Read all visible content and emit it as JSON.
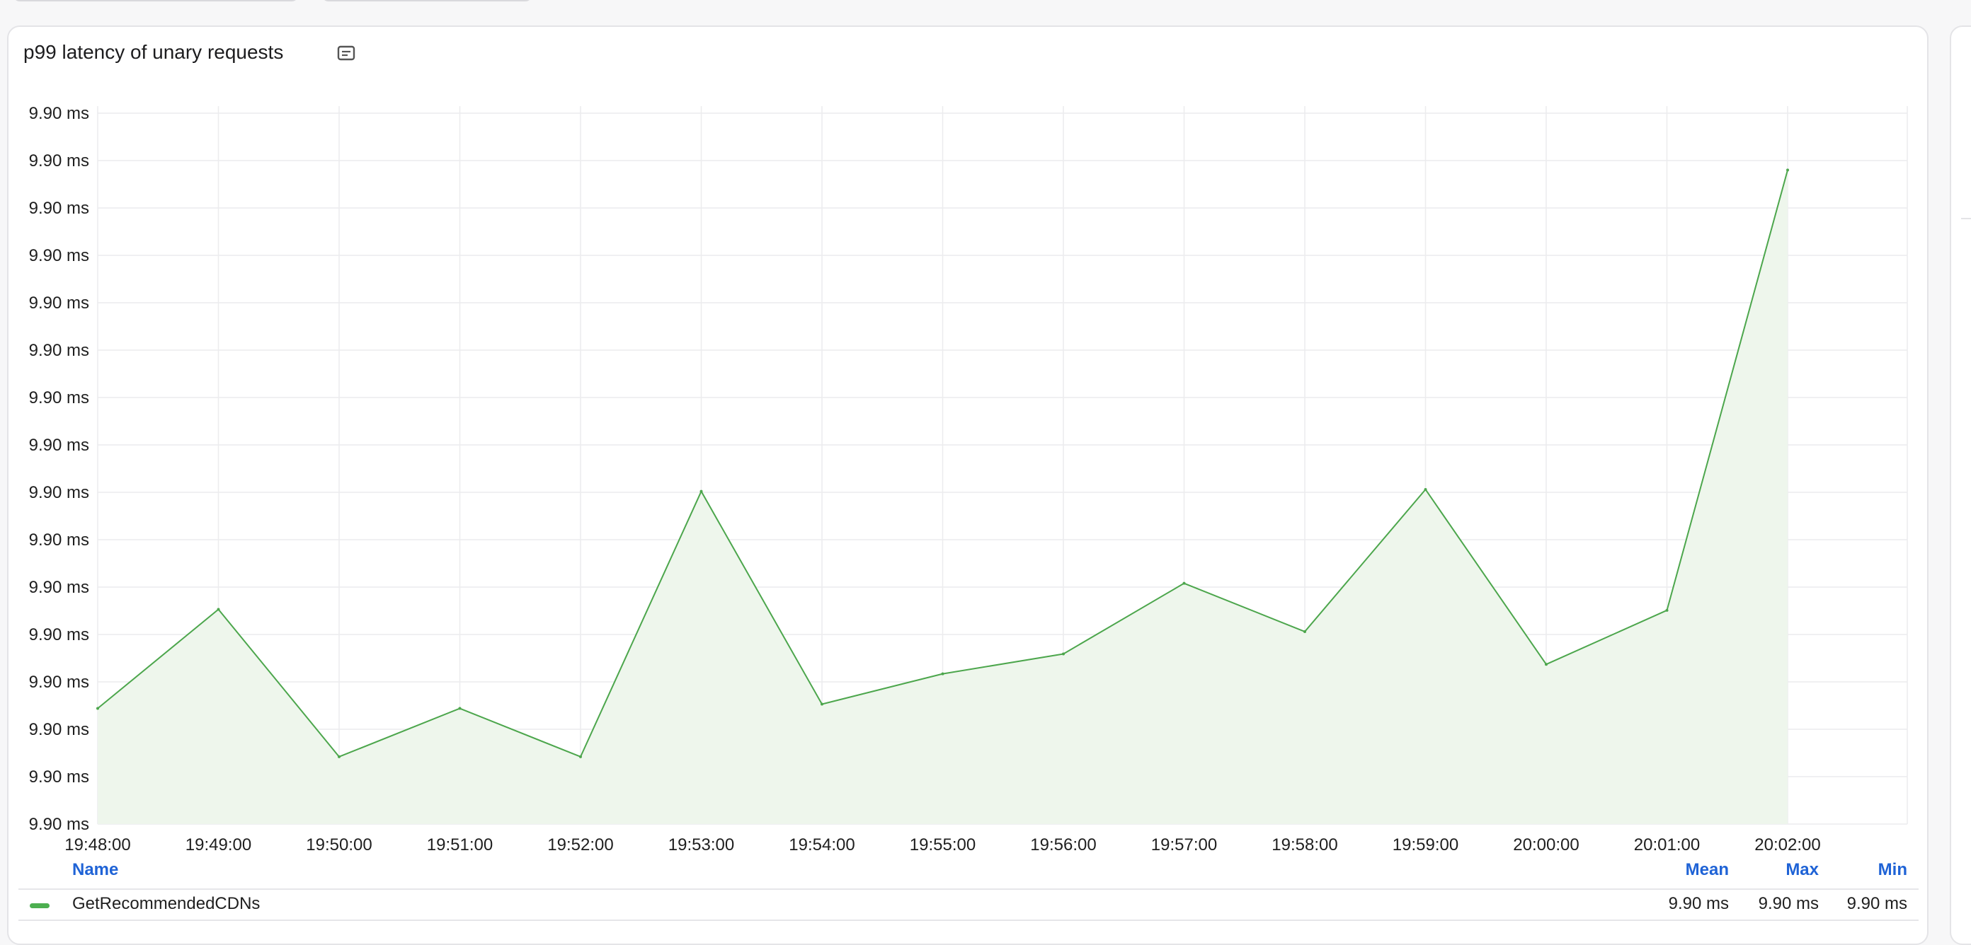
{
  "panel": {
    "title": "p99 latency of unary requests",
    "info_icon": "description-icon"
  },
  "legend": {
    "headers": {
      "name": "Name",
      "mean": "Mean",
      "max": "Max",
      "min": "Min"
    },
    "rows": [
      {
        "name": "GetRecommendedCDNs",
        "mean": "9.90 ms",
        "max": "9.90 ms",
        "min": "9.90 ms",
        "color": "#4caf50"
      }
    ]
  },
  "colors": {
    "line": "#4ca64c",
    "fill": "#eef6ec",
    "grid": "#ececee",
    "header": "#1f63d6"
  },
  "chart_data": {
    "type": "area",
    "title": "p99 latency of unary requests",
    "xlabel": "",
    "ylabel": "",
    "x": [
      "19:48:00",
      "19:49:00",
      "19:50:00",
      "19:51:00",
      "19:52:00",
      "19:53:00",
      "19:54:00",
      "19:55:00",
      "19:56:00",
      "19:57:00",
      "19:58:00",
      "19:59:00",
      "20:00:00",
      "20:01:00",
      "20:02:00"
    ],
    "y_tick_labels": [
      "9.90 ms",
      "9.90 ms",
      "9.90 ms",
      "9.90 ms",
      "9.90 ms",
      "9.90 ms",
      "9.90 ms",
      "9.90 ms",
      "9.90 ms",
      "9.90 ms",
      "9.90 ms",
      "9.90 ms",
      "9.90 ms",
      "9.90 ms",
      "9.90 ms",
      "9.90 ms"
    ],
    "ylim": [
      0,
      15
    ],
    "grid": true,
    "legend_position": "bottom",
    "series": [
      {
        "name": "GetRecommendedCDNs",
        "color": "#4ca64c",
        "values": [
          2.44,
          4.53,
          1.42,
          2.44,
          1.42,
          7.02,
          2.53,
          3.17,
          3.59,
          5.08,
          4.06,
          7.06,
          3.37,
          4.51,
          13.8
        ]
      }
    ]
  }
}
